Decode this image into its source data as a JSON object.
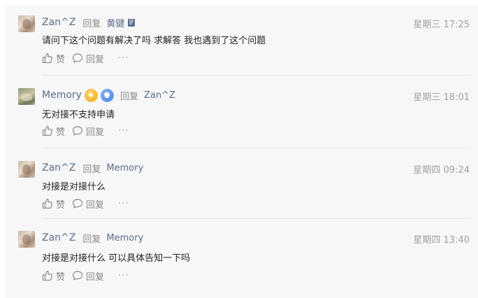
{
  "comments": [
    {
      "user": "Zan^Z",
      "reply_word": "回复",
      "reply_to": "黄键",
      "time": "星期三 17:25",
      "content": "请问下这个问题有解决了吗 求解答 我也遇到了这个问题",
      "like_label": "赞",
      "reply_label": "回复",
      "more_label": "···"
    },
    {
      "user": "Memory",
      "reply_word": "回复",
      "reply_to": "Zan^Z",
      "time": "星期三 18:01",
      "content": "无对接不支持申请",
      "like_label": "赞",
      "reply_label": "回复",
      "more_label": "···"
    },
    {
      "user": "Zan^Z",
      "reply_word": "回复",
      "reply_to": "Memory",
      "time": "星期四 09:24",
      "content": "对接是对接什么",
      "like_label": "赞",
      "reply_label": "回复",
      "more_label": "···"
    },
    {
      "user": "Zan^Z",
      "reply_word": "回复",
      "reply_to": "Memory",
      "time": "星期四 13:40",
      "content": "对接是对接什么 可以具体告知一下吗",
      "like_label": "赞",
      "reply_label": "回复",
      "more_label": "···"
    }
  ],
  "colors": {
    "username": "#5a6b8c",
    "muted": "#8a8a8a",
    "time": "#a0a0a0",
    "panel_bg": "#f7f7f7"
  },
  "icons": {
    "like": "thumbs-up-icon",
    "reply": "speech-bubble-icon",
    "more": "ellipsis-icon",
    "memory_badge_1": "gold-star-medal-icon",
    "memory_badge_2": "blue-shield-medal-icon",
    "reply_target_badge": "bookmark-badge-icon"
  }
}
